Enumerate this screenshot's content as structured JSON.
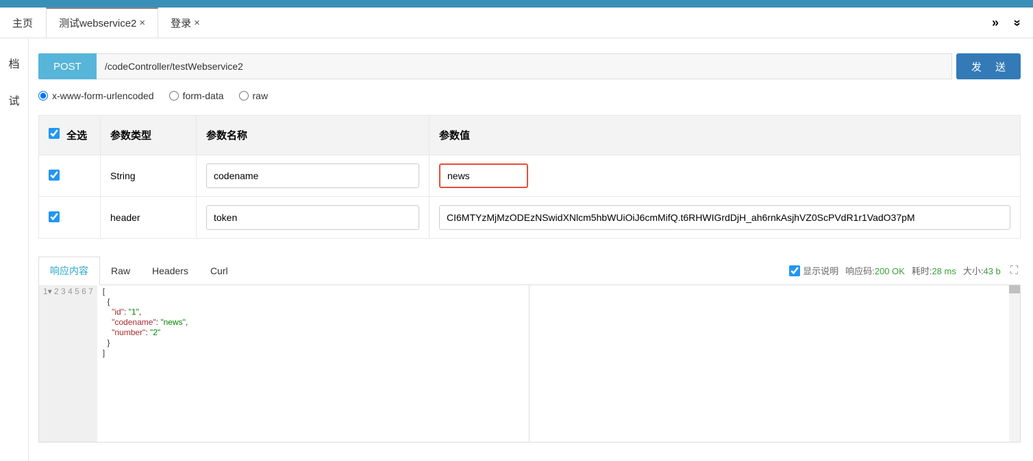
{
  "topbar_color": "#3a8fb7",
  "tabs": [
    {
      "label": "主页",
      "closable": false
    },
    {
      "label": "测试webservice2",
      "closable": true,
      "active": true
    },
    {
      "label": "登录",
      "closable": true
    }
  ],
  "left_sidebar": {
    "item1": "档",
    "item2": "试"
  },
  "request": {
    "method": "POST",
    "url": "/codeController/testWebservice2",
    "send_label": "发 送"
  },
  "body_types": {
    "urlencoded": "x-www-form-urlencoded",
    "formdata": "form-data",
    "raw": "raw",
    "selected": "urlencoded"
  },
  "params": {
    "headers": {
      "select_all": "全选",
      "type": "参数类型",
      "name": "参数名称",
      "value": "参数值"
    },
    "rows": [
      {
        "checked": true,
        "type": "String",
        "name": "codename",
        "value": "news",
        "highlight_value": true
      },
      {
        "checked": true,
        "type": "header",
        "name": "token",
        "value": "CI6MTYzMjMzODEzNSwidXNlcm5hbWUiOiJ6cmMifQ.t6RHWIGrdDjH_ah6rnkAsjhVZ0ScPVdR1r1VadO37pM"
      }
    ]
  },
  "response": {
    "tabs": [
      "响应内容",
      "Raw",
      "Headers",
      "Curl"
    ],
    "active_tab": "响应内容",
    "show_desc_label": "显示说明",
    "show_desc_checked": true,
    "status_label": "响应码:",
    "status": "200 OK",
    "time_label": "耗时:",
    "time": "28 ms",
    "size_label": "大小:",
    "size": "43 b",
    "body": {
      "id_key": "\"id\"",
      "id_val": "\"1\"",
      "codename_key": "\"codename\"",
      "codename_val": "\"news\"",
      "number_key": "\"number\"",
      "number_val": "\"2\""
    }
  }
}
